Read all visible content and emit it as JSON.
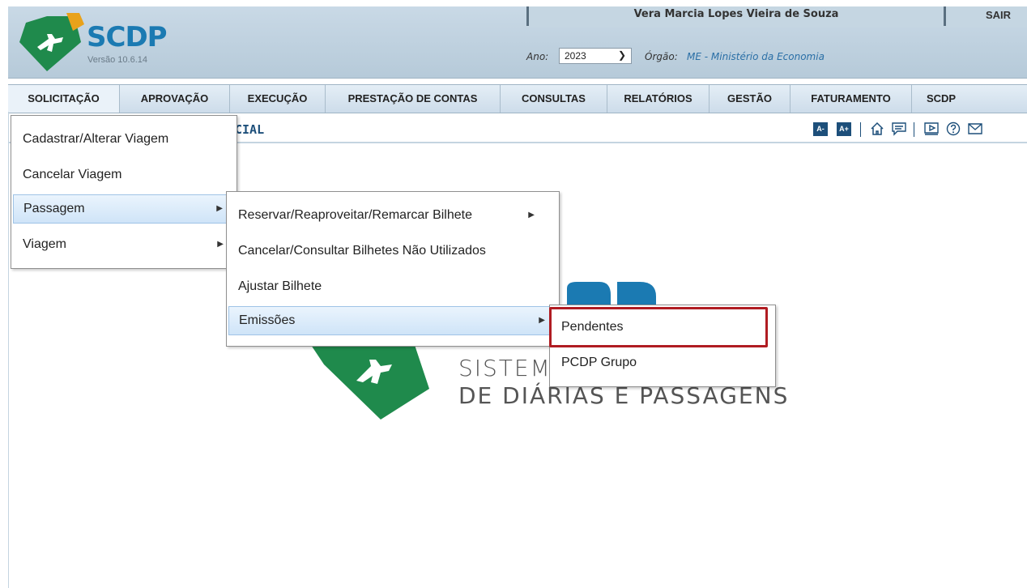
{
  "header": {
    "app_name": "SCDP",
    "version": "Versão 10.6.14",
    "user_name": "Vera Marcia Lopes Vieira de Souza",
    "logout_label": "SAIR",
    "year_label": "Ano:",
    "year_value": "2023",
    "org_label": "Órgão:",
    "org_value": "ME - Ministério da Economia"
  },
  "nav": {
    "items": [
      "SOLICITAÇÃO",
      "APROVAÇÃO",
      "EXECUÇÃO",
      "PRESTAÇÃO DE CONTAS",
      "CONSULTAS",
      "RELATÓRIOS",
      "GESTÃO",
      "FATURAMENTO",
      "SCDP"
    ],
    "active": "SOLICITAÇÃO"
  },
  "page": {
    "title_fragment": "CIAL",
    "font_decrease": "A-",
    "font_increase": "A+"
  },
  "watermark": {
    "line1": "SISTEMA",
    "line2": "DE DIÁRIAS E PASSAGENS"
  },
  "menu_l1": [
    "Cadastrar/Alterar Viagem",
    "Cancelar Viagem",
    "Passagem",
    "Viagem"
  ],
  "menu_l2": [
    "Reservar/Reaproveitar/Remarcar Bilhete",
    "Cancelar/Consultar Bilhetes Não Utilizados",
    "Ajustar Bilhete",
    "Emissões"
  ],
  "menu_l3": [
    "Pendentes",
    "PCDP Grupo"
  ],
  "icons": {
    "home": "home-icon",
    "chat": "chat-icon",
    "video": "video-icon",
    "help": "help-icon",
    "mail": "mail-icon"
  },
  "colors": {
    "brand_green": "#1f8a4c",
    "brand_blue": "#1b7ab2",
    "highlight_red": "#b01c22"
  }
}
